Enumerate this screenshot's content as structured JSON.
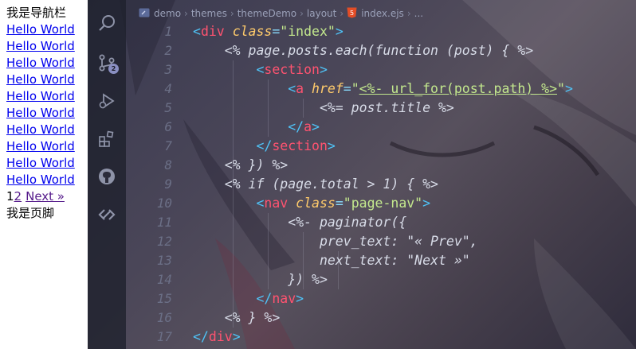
{
  "preview": {
    "header": "我是导航栏",
    "posts": [
      "Hello World",
      "Hello World",
      "Hello World",
      "Hello World",
      "Hello World",
      "Hello World",
      "Hello World",
      "Hello World",
      "Hello World",
      "Hello World"
    ],
    "pager": {
      "page1": "1",
      "page2": "2",
      "next": "Next »"
    },
    "footer": "我是页脚"
  },
  "activity_bar": {
    "icons": [
      "search-icon",
      "source-control-icon",
      "debug-icon",
      "extensions-icon",
      "github-icon",
      "remote-icon"
    ],
    "source_control_badge": "2"
  },
  "breadcrumb": {
    "items": [
      "demo",
      "themes",
      "themeDemo",
      "layout"
    ],
    "file": "index.ejs",
    "ellipsis": "..."
  },
  "editor": {
    "line_numbers": [
      "1",
      "2",
      "3",
      "4",
      "5",
      "6",
      "7",
      "8",
      "9",
      "10",
      "11",
      "12",
      "13",
      "14",
      "15",
      "16",
      "17"
    ],
    "lines": [
      [
        [
          "br",
          "<"
        ],
        [
          "tag",
          "div"
        ],
        [
          "txt",
          " "
        ],
        [
          "attr",
          "class"
        ],
        [
          "eq",
          "="
        ],
        [
          "str",
          "\"index\""
        ],
        [
          "br",
          ">"
        ]
      ],
      [
        [
          "txt",
          "    <% page.posts.each(function (post) { %>"
        ]
      ],
      [
        [
          "txt",
          "        "
        ],
        [
          "br",
          "<"
        ],
        [
          "tag",
          "section"
        ],
        [
          "br",
          ">"
        ]
      ],
      [
        [
          "txt",
          "            "
        ],
        [
          "br",
          "<"
        ],
        [
          "tag",
          "a"
        ],
        [
          "txt",
          " "
        ],
        [
          "attr",
          "href"
        ],
        [
          "eq",
          "="
        ],
        [
          "str",
          "\""
        ],
        [
          "strlink",
          "<%- url_for(post.path) %>"
        ],
        [
          "str",
          "\""
        ],
        [
          "br",
          ">"
        ]
      ],
      [
        [
          "txt",
          "                <%= post.title %>"
        ]
      ],
      [
        [
          "txt",
          "            "
        ],
        [
          "br",
          "</"
        ],
        [
          "tag",
          "a"
        ],
        [
          "br",
          ">"
        ]
      ],
      [
        [
          "txt",
          "        "
        ],
        [
          "br",
          "</"
        ],
        [
          "tag",
          "section"
        ],
        [
          "br",
          ">"
        ]
      ],
      [
        [
          "txt",
          "    <% }) %>"
        ]
      ],
      [
        [
          "txt",
          "    <% if (page.total > 1) { %>"
        ]
      ],
      [
        [
          "txt",
          "        "
        ],
        [
          "br",
          "<"
        ],
        [
          "tag",
          "nav"
        ],
        [
          "txt",
          " "
        ],
        [
          "attr",
          "class"
        ],
        [
          "eq",
          "="
        ],
        [
          "str",
          "\"page-nav\""
        ],
        [
          "br",
          ">"
        ]
      ],
      [
        [
          "txt",
          "            <%- paginator({"
        ]
      ],
      [
        [
          "txt",
          "                prev_text: \"« Prev\","
        ]
      ],
      [
        [
          "txt",
          "                next_text: \"Next »\""
        ]
      ],
      [
        [
          "txt",
          "            }) %>"
        ]
      ],
      [
        [
          "txt",
          "        "
        ],
        [
          "br",
          "</"
        ],
        [
          "tag",
          "nav"
        ],
        [
          "br",
          ">"
        ]
      ],
      [
        [
          "txt",
          "    <% } %>"
        ]
      ],
      [
        [
          "br",
          "</"
        ],
        [
          "tag",
          "div"
        ],
        [
          "br",
          ">"
        ]
      ]
    ]
  },
  "colors": {
    "bracket": "#4fc3f7",
    "tag": "#ff5370",
    "attribute": "#ffcb6b",
    "string": "#c3e88d",
    "text": "#d8dce8",
    "line_number": "#6b6f86"
  }
}
